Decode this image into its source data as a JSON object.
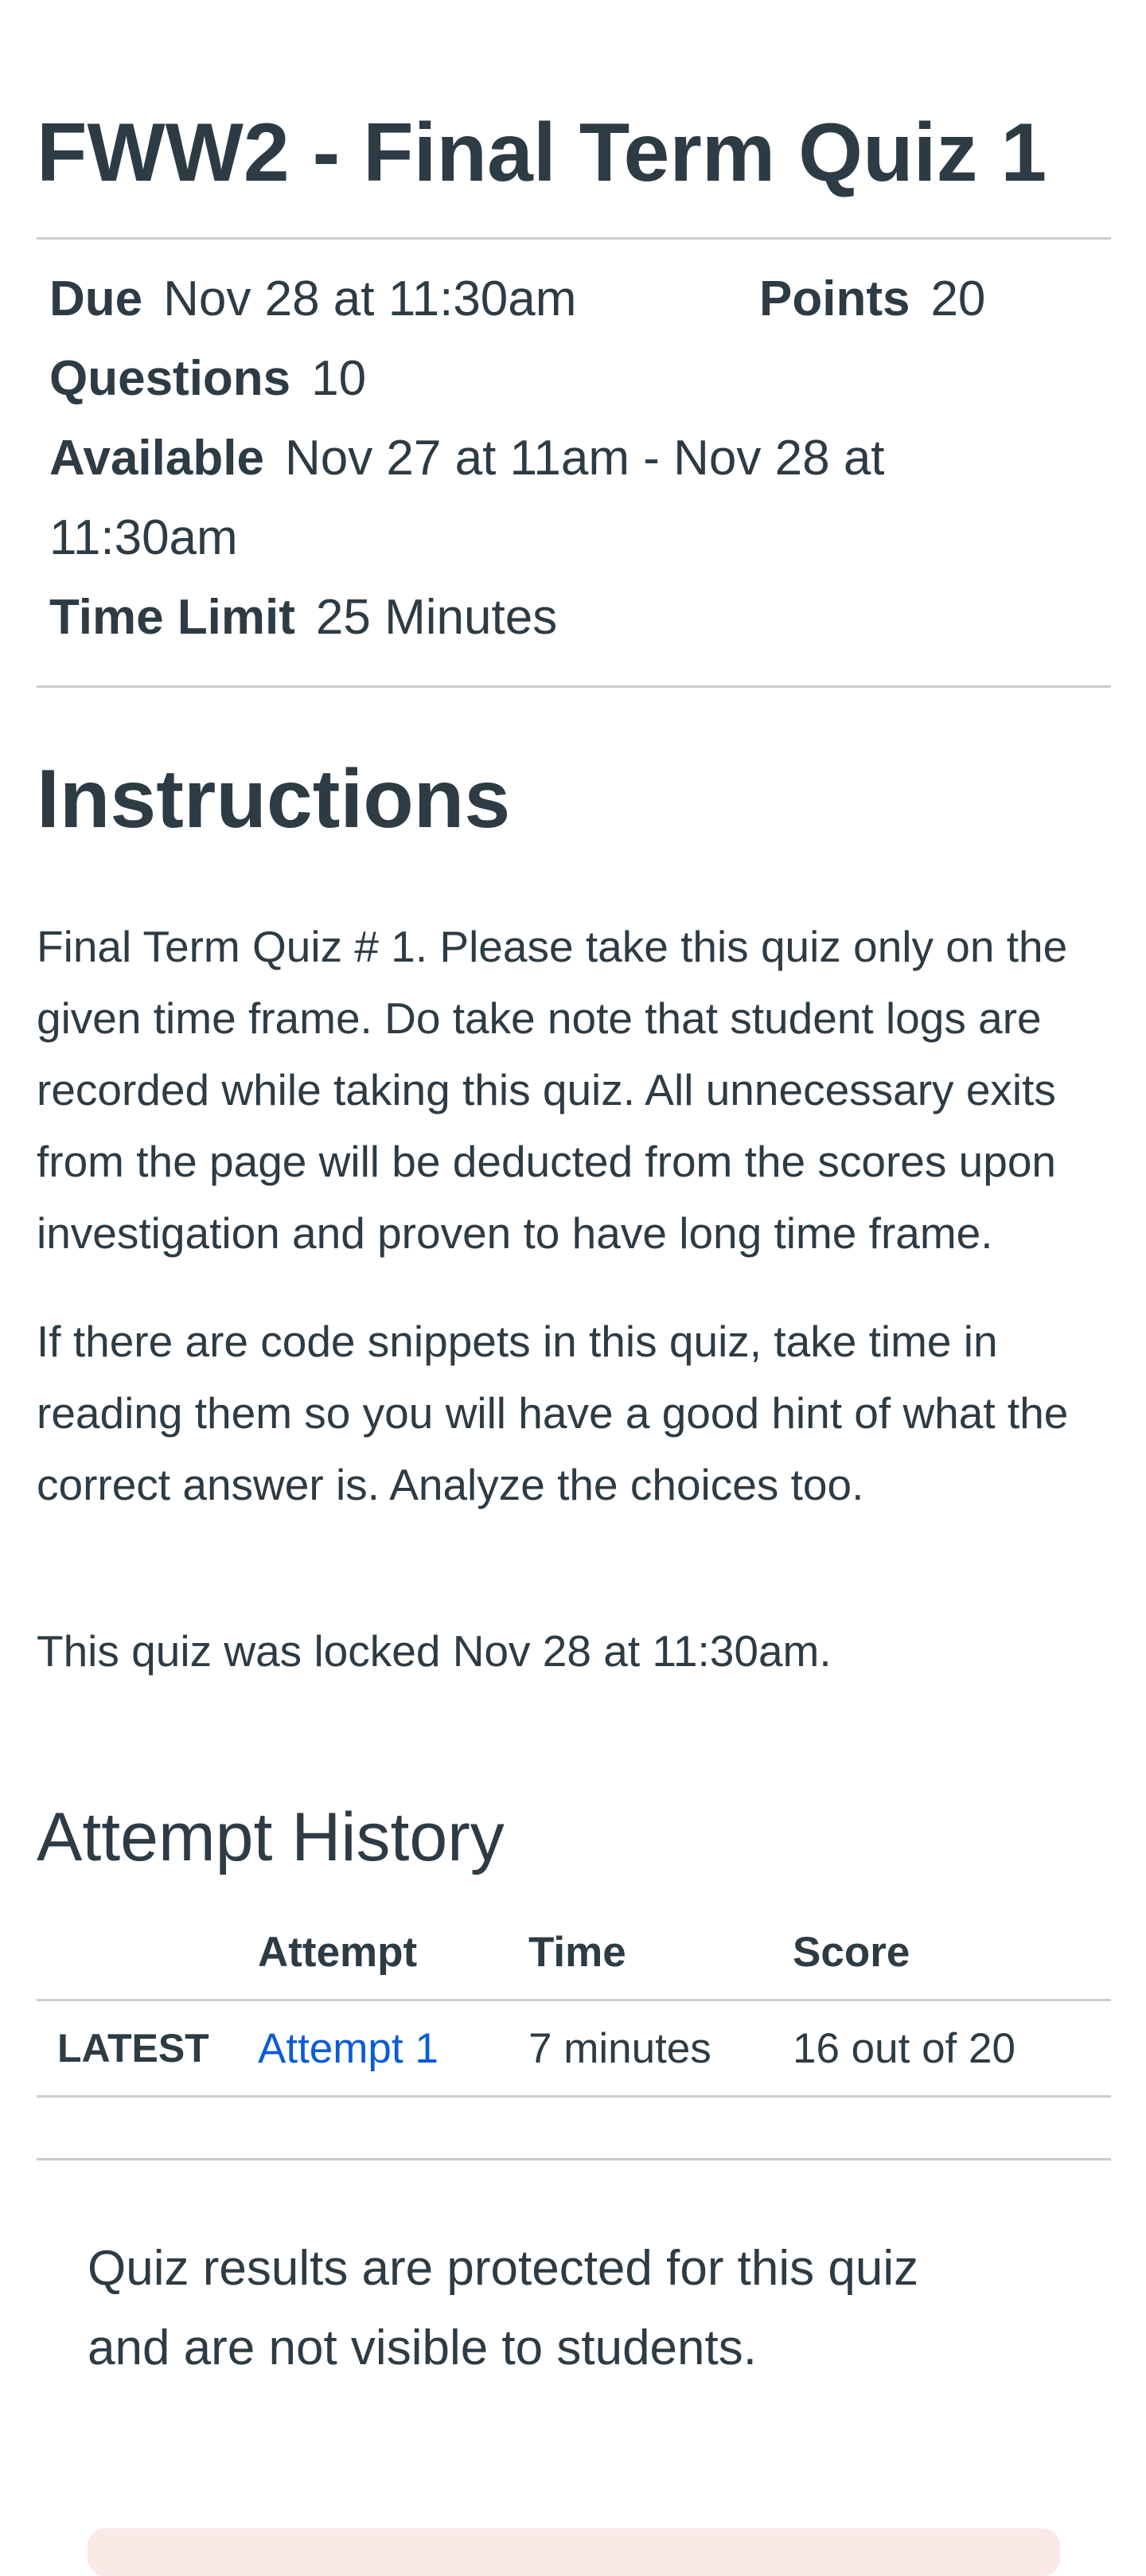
{
  "quiz": {
    "title": "FWW2 - Final Term Quiz 1",
    "details": {
      "due_label": "Due",
      "due_value": "Nov 28 at 11:30am",
      "points_label": "Points",
      "points_value": "20",
      "questions_label": "Questions",
      "questions_value": "10",
      "available_label": "Available",
      "available_value_line1": "Nov 27 at 11am - Nov 28 at",
      "available_value_line2": "11:30am",
      "time_limit_label": "Time Limit",
      "time_limit_value": "25 Minutes"
    }
  },
  "instructions": {
    "heading": "Instructions",
    "paragraph1": "Final Term Quiz # 1. Please take this quiz only on the given time frame. Do take note that student logs are recorded while taking this quiz. All unnecessary exits from the page will be deducted from the scores upon investigation and proven to have long time frame.",
    "paragraph2": "If there are code snippets in this quiz, take time in reading them so you will have a good hint of what the correct answer is. Analyze the choices too."
  },
  "lock_notice": "This quiz was locked Nov 28 at 11:30am.",
  "attempt_history": {
    "heading": "Attempt History",
    "columns": [
      "Attempt",
      "Time",
      "Score"
    ],
    "rows": [
      {
        "tag": "LATEST",
        "attempt": "Attempt 1",
        "time": "7 minutes",
        "score": "16 out of 20"
      }
    ]
  },
  "results_notice": {
    "line1": "Quiz results are protected for this quiz",
    "line2": "and are not visible to students."
  },
  "colors": {
    "text": "#2d3b45",
    "link": "#0b5cd5",
    "rule": "#c7cdd1",
    "alert_bg": "#fbe9e7"
  }
}
